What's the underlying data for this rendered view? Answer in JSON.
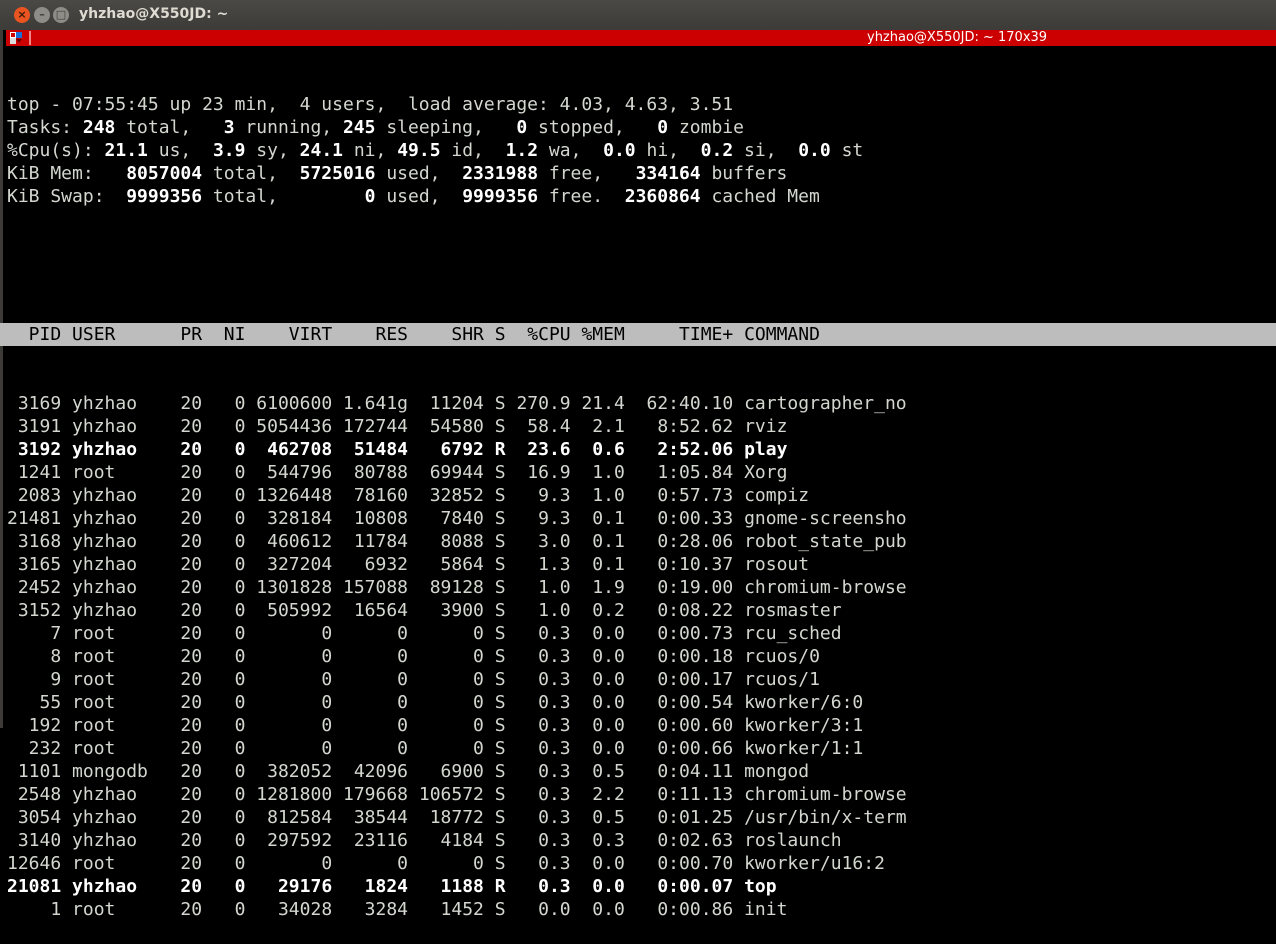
{
  "window": {
    "title": "yhzhao@X550JD: ~",
    "tab_title": "yhzhao@X550JD: ~ 170x39"
  },
  "summary": [
    [
      {
        "t": "top - 07:55:45 up 23 min,  4 users,  load average: 4.03, 4.63, 3.51",
        "b": false
      }
    ],
    [
      {
        "t": "Tasks: ",
        "b": false
      },
      {
        "t": "248",
        "b": true
      },
      {
        "t": " total,   ",
        "b": false
      },
      {
        "t": "3",
        "b": true
      },
      {
        "t": " running, ",
        "b": false
      },
      {
        "t": "245",
        "b": true
      },
      {
        "t": " sleeping,   ",
        "b": false
      },
      {
        "t": "0",
        "b": true
      },
      {
        "t": " stopped,   ",
        "b": false
      },
      {
        "t": "0",
        "b": true
      },
      {
        "t": " zombie",
        "b": false
      }
    ],
    [
      {
        "t": "%Cpu(s): ",
        "b": false
      },
      {
        "t": "21.1",
        "b": true
      },
      {
        "t": " us,  ",
        "b": false
      },
      {
        "t": "3.9",
        "b": true
      },
      {
        "t": " sy, ",
        "b": false
      },
      {
        "t": "24.1",
        "b": true
      },
      {
        "t": " ni, ",
        "b": false
      },
      {
        "t": "49.5",
        "b": true
      },
      {
        "t": " id,  ",
        "b": false
      },
      {
        "t": "1.2",
        "b": true
      },
      {
        "t": " wa,  ",
        "b": false
      },
      {
        "t": "0.0",
        "b": true
      },
      {
        "t": " hi,  ",
        "b": false
      },
      {
        "t": "0.2",
        "b": true
      },
      {
        "t": " si,  ",
        "b": false
      },
      {
        "t": "0.0",
        "b": true
      },
      {
        "t": " st",
        "b": false
      }
    ],
    [
      {
        "t": "KiB Mem:   ",
        "b": false
      },
      {
        "t": "8057004",
        "b": true
      },
      {
        "t": " total,  ",
        "b": false
      },
      {
        "t": "5725016",
        "b": true
      },
      {
        "t": " used,  ",
        "b": false
      },
      {
        "t": "2331988",
        "b": true
      },
      {
        "t": " free,   ",
        "b": false
      },
      {
        "t": "334164",
        "b": true
      },
      {
        "t": " buffers",
        "b": false
      }
    ],
    [
      {
        "t": "KiB Swap:  ",
        "b": false
      },
      {
        "t": "9999356",
        "b": true
      },
      {
        "t": " total,        ",
        "b": false
      },
      {
        "t": "0",
        "b": true
      },
      {
        "t": " used,  ",
        "b": false
      },
      {
        "t": "9999356",
        "b": true
      },
      {
        "t": " free.  ",
        "b": false
      },
      {
        "t": "2360864",
        "b": true
      },
      {
        "t": " cached Mem",
        "b": false
      }
    ]
  ],
  "columns": [
    "PID",
    "USER",
    "PR",
    "NI",
    "VIRT",
    "RES",
    "SHR",
    "S",
    "%CPU",
    "%MEM",
    "TIME+",
    "COMMAND"
  ],
  "processes": [
    {
      "r": [
        "3169",
        "yhzhao",
        "20",
        "0",
        "6100600",
        "1.641g",
        "11204",
        "S",
        "270.9",
        "21.4",
        "62:40.10",
        "cartographer_no"
      ],
      "bold": false
    },
    {
      "r": [
        "3191",
        "yhzhao",
        "20",
        "0",
        "5054436",
        "172744",
        "54580",
        "S",
        "58.4",
        "2.1",
        "8:52.62",
        "rviz"
      ],
      "bold": false
    },
    {
      "r": [
        "3192",
        "yhzhao",
        "20",
        "0",
        "462708",
        "51484",
        "6792",
        "R",
        "23.6",
        "0.6",
        "2:52.06",
        "play"
      ],
      "bold": true
    },
    {
      "r": [
        "1241",
        "root",
        "20",
        "0",
        "544796",
        "80788",
        "69944",
        "S",
        "16.9",
        "1.0",
        "1:05.84",
        "Xorg"
      ],
      "bold": false
    },
    {
      "r": [
        "2083",
        "yhzhao",
        "20",
        "0",
        "1326448",
        "78160",
        "32852",
        "S",
        "9.3",
        "1.0",
        "0:57.73",
        "compiz"
      ],
      "bold": false
    },
    {
      "r": [
        "21481",
        "yhzhao",
        "20",
        "0",
        "328184",
        "10808",
        "7840",
        "S",
        "9.3",
        "0.1",
        "0:00.33",
        "gnome-screensho"
      ],
      "bold": false
    },
    {
      "r": [
        "3168",
        "yhzhao",
        "20",
        "0",
        "460612",
        "11784",
        "8088",
        "S",
        "3.0",
        "0.1",
        "0:28.06",
        "robot_state_pub"
      ],
      "bold": false
    },
    {
      "r": [
        "3165",
        "yhzhao",
        "20",
        "0",
        "327204",
        "6932",
        "5864",
        "S",
        "1.3",
        "0.1",
        "0:10.37",
        "rosout"
      ],
      "bold": false
    },
    {
      "r": [
        "2452",
        "yhzhao",
        "20",
        "0",
        "1301828",
        "157088",
        "89128",
        "S",
        "1.0",
        "1.9",
        "0:19.00",
        "chromium-browse"
      ],
      "bold": false
    },
    {
      "r": [
        "3152",
        "yhzhao",
        "20",
        "0",
        "505992",
        "16564",
        "3900",
        "S",
        "1.0",
        "0.2",
        "0:08.22",
        "rosmaster"
      ],
      "bold": false
    },
    {
      "r": [
        "7",
        "root",
        "20",
        "0",
        "0",
        "0",
        "0",
        "S",
        "0.3",
        "0.0",
        "0:00.73",
        "rcu_sched"
      ],
      "bold": false
    },
    {
      "r": [
        "8",
        "root",
        "20",
        "0",
        "0",
        "0",
        "0",
        "S",
        "0.3",
        "0.0",
        "0:00.18",
        "rcuos/0"
      ],
      "bold": false
    },
    {
      "r": [
        "9",
        "root",
        "20",
        "0",
        "0",
        "0",
        "0",
        "S",
        "0.3",
        "0.0",
        "0:00.17",
        "rcuos/1"
      ],
      "bold": false
    },
    {
      "r": [
        "55",
        "root",
        "20",
        "0",
        "0",
        "0",
        "0",
        "S",
        "0.3",
        "0.0",
        "0:00.54",
        "kworker/6:0"
      ],
      "bold": false
    },
    {
      "r": [
        "192",
        "root",
        "20",
        "0",
        "0",
        "0",
        "0",
        "S",
        "0.3",
        "0.0",
        "0:00.60",
        "kworker/3:1"
      ],
      "bold": false
    },
    {
      "r": [
        "232",
        "root",
        "20",
        "0",
        "0",
        "0",
        "0",
        "S",
        "0.3",
        "0.0",
        "0:00.66",
        "kworker/1:1"
      ],
      "bold": false
    },
    {
      "r": [
        "1101",
        "mongodb",
        "20",
        "0",
        "382052",
        "42096",
        "6900",
        "S",
        "0.3",
        "0.5",
        "0:04.11",
        "mongod"
      ],
      "bold": false
    },
    {
      "r": [
        "2548",
        "yhzhao",
        "20",
        "0",
        "1281800",
        "179668",
        "106572",
        "S",
        "0.3",
        "2.2",
        "0:11.13",
        "chromium-browse"
      ],
      "bold": false
    },
    {
      "r": [
        "3054",
        "yhzhao",
        "20",
        "0",
        "812584",
        "38544",
        "18772",
        "S",
        "0.3",
        "0.5",
        "0:01.25",
        "/usr/bin/x-term"
      ],
      "bold": false
    },
    {
      "r": [
        "3140",
        "yhzhao",
        "20",
        "0",
        "297592",
        "23116",
        "4184",
        "S",
        "0.3",
        "0.3",
        "0:02.63",
        "roslaunch"
      ],
      "bold": false
    },
    {
      "r": [
        "12646",
        "root",
        "20",
        "0",
        "0",
        "0",
        "0",
        "S",
        "0.3",
        "0.0",
        "0:00.70",
        "kworker/u16:2"
      ],
      "bold": false
    },
    {
      "r": [
        "21081",
        "yhzhao",
        "20",
        "0",
        "29176",
        "1824",
        "1188",
        "R",
        "0.3",
        "0.0",
        "0:00.07",
        "top"
      ],
      "bold": true
    },
    {
      "r": [
        "1",
        "root",
        "20",
        "0",
        "34028",
        "3284",
        "1452",
        "S",
        "0.0",
        "0.0",
        "0:00.86",
        "init"
      ],
      "bold": false
    }
  ]
}
